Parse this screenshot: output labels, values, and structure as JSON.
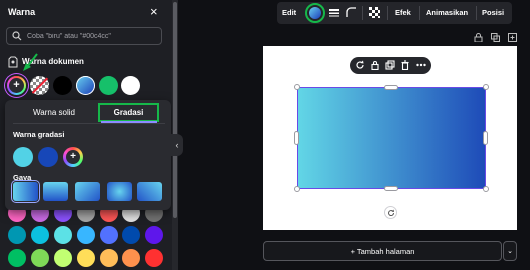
{
  "panel": {
    "title": "Warna",
    "close": "×",
    "search": {
      "placeholder": "Coba \"biru\" atau \"#00c4cc\""
    },
    "document_colors_label": "Warna dokumen",
    "add_color": "+"
  },
  "popup": {
    "tab_solid": "Warna solid",
    "tab_gradient": "Gradasi",
    "gradient_colors_title": "Warna gradasi",
    "style_title": "Gaya",
    "add_color": "+"
  },
  "toolbar": {
    "edit": "Edit",
    "effects": "Efek",
    "animate": "Animasikan",
    "position": "Posisi"
  },
  "canvas": {
    "add_page": "+  Tambah halaman",
    "more": "⌄"
  },
  "colors": {
    "accent_green": "#16b84a",
    "gradient_start": "#62d6e6",
    "gradient_end": "#1e4bb8",
    "palette": [
      "#00a6b4",
      "#00c4cc",
      "#5ce1e6",
      "#38b6ff",
      "#5271ff",
      "#004aad",
      "#5d17eb",
      "#16a34a",
      "#7ed957",
      "#c1ff72",
      "#ffde59",
      "#ffbd59",
      "#ff914d",
      "#ff3131"
    ]
  }
}
